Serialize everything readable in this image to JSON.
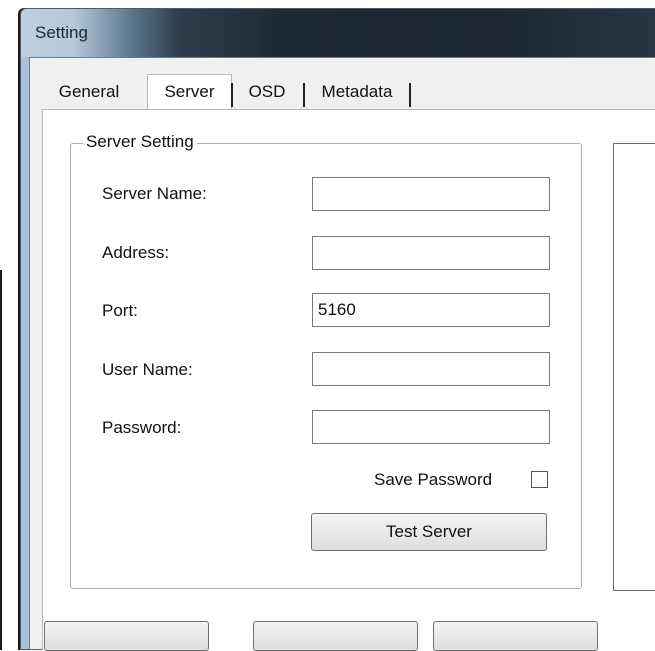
{
  "window": {
    "title": "Setting"
  },
  "tabs": [
    {
      "label": "General",
      "active": false
    },
    {
      "label": "Server",
      "active": true
    },
    {
      "label": "OSD",
      "active": false
    },
    {
      "label": "Metadata",
      "active": false
    }
  ],
  "server_setting": {
    "group_label": "Server Setting",
    "fields": [
      {
        "label": "Server Name:",
        "value": ""
      },
      {
        "label": "Address:",
        "value": ""
      },
      {
        "label": "Port:",
        "value": "5160"
      },
      {
        "label": "User Name:",
        "value": ""
      },
      {
        "label": "Password:",
        "value": ""
      }
    ],
    "save_password_label": "Save Password",
    "save_password_checked": false,
    "test_button_label": "Test Server"
  },
  "colors": {
    "titlebar_dark": "#1c2530",
    "titlebar_light": "#bccfde",
    "panel_bg": "#ffffff"
  }
}
